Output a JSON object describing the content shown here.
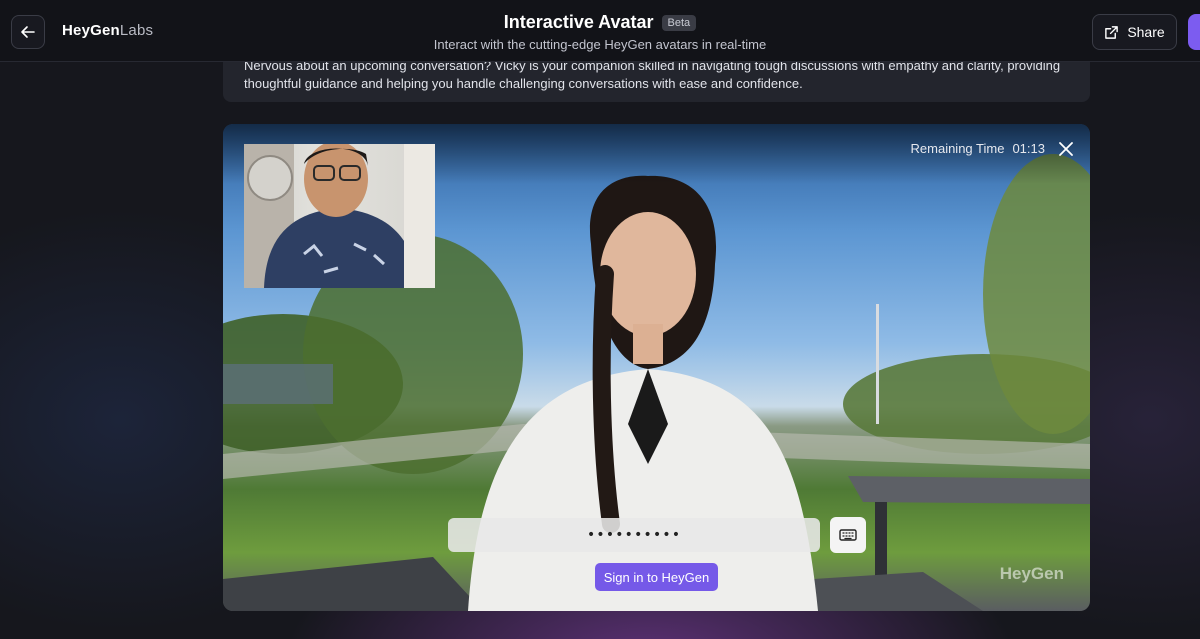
{
  "header": {
    "logo_bold": "HeyGen",
    "logo_light": "Labs",
    "title": "Interactive Avatar",
    "badge": "Beta",
    "subtitle": "Interact with the cutting-edge HeyGen avatars in real-time",
    "share_label": "Share",
    "back_icon": "arrow-left-icon",
    "share_icon": "external-link-icon"
  },
  "description": "Nervous about an upcoming conversation? Vicky is your companion skilled in navigating tough discussions with empathy and clarity, providing thoughtful guidance and helping you handle challenging conversations with ease and confidence.",
  "video": {
    "remaining_label": "Remaining Time",
    "remaining_value": "01:13",
    "input_value": "••••••••••",
    "signin_label": "Sign in to HeyGen",
    "watermark": "HeyGen",
    "keyboard_icon": "keyboard-icon",
    "close_icon": "close-icon"
  },
  "colors": {
    "accent": "#7559e8",
    "background": "#16171d",
    "card": "#23252d"
  }
}
